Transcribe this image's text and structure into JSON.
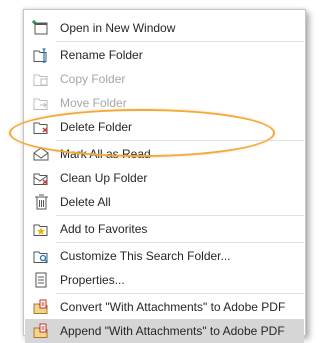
{
  "menu": {
    "items": [
      {
        "label": "Open in New Window",
        "icon": "open-window-icon",
        "disabled": false
      },
      {
        "label": "Rename Folder",
        "icon": "rename-folder-icon",
        "disabled": false
      },
      {
        "label": "Copy Folder",
        "icon": "copy-folder-icon",
        "disabled": true
      },
      {
        "label": "Move Folder",
        "icon": "move-folder-icon",
        "disabled": true
      },
      {
        "label": "Delete Folder",
        "icon": "delete-folder-icon",
        "disabled": false
      },
      {
        "label": "Mark All as Read",
        "icon": "mark-read-icon",
        "disabled": false
      },
      {
        "label": "Clean Up Folder",
        "icon": "clean-up-icon",
        "disabled": false
      },
      {
        "label": "Delete All",
        "icon": "delete-all-icon",
        "disabled": false
      },
      {
        "label": "Add to Favorites",
        "icon": "favorites-star-icon",
        "disabled": false
      },
      {
        "label": "Customize This Search Folder...",
        "icon": "search-folder-icon",
        "disabled": false
      },
      {
        "label": "Properties...",
        "icon": "properties-icon",
        "disabled": false
      },
      {
        "label": "Convert \"With Attachments\" to Adobe PDF",
        "icon": "adobe-pdf-icon",
        "disabled": false
      },
      {
        "label": "Append \"With Attachments\" to Adobe PDF",
        "icon": "adobe-pdf-append-icon",
        "disabled": false
      }
    ]
  },
  "colors": {
    "highlight_ring": "#f2a93b",
    "hover_row": "#d6d6d6",
    "text": "#262626",
    "disabled_text": "#a6a6a6"
  }
}
